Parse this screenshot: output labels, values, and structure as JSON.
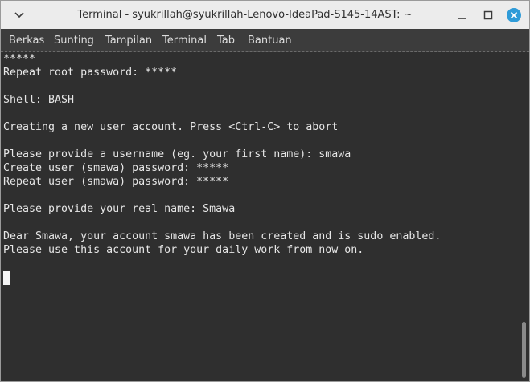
{
  "window": {
    "title": "Terminal - syukrillah@syukrillah-Lenovo-IdeaPad-S145-14AST: ~"
  },
  "title_controls": {
    "menu_icon": "chevron-down-icon",
    "minimize_icon": "minimize-icon",
    "maximize_icon": "maximize-icon",
    "close_icon": "close-icon",
    "close_color": "#2f9bd8"
  },
  "menubar": {
    "items": [
      "Berkas",
      "Sunting",
      "Tampilan",
      "Terminal",
      "Tab",
      "Bantuan"
    ]
  },
  "terminal": {
    "lines": [
      "*****",
      "Repeat root password: *****",
      "",
      "Shell: BASH",
      "",
      "Creating a new user account. Press <Ctrl-C> to abort",
      "",
      "Please provide a username (eg. your first name): smawa",
      "Create user (smawa) password: *****",
      "Repeat user (smawa) password: *****",
      "",
      "Please provide your real name: Smawa",
      "",
      "Dear Smawa, your account smawa has been created and is sudo enabled.",
      "Please use this account for your daily work from now on.",
      ""
    ],
    "background": "#2f2f2f",
    "foreground": "#e6e6e6"
  }
}
